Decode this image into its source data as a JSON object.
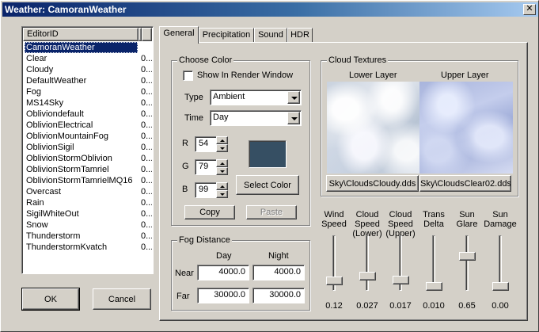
{
  "window": {
    "title": "Weather: CamoranWeather"
  },
  "list": {
    "header": "EditorID",
    "items": [
      {
        "name": "CamoranWeather",
        "extra": "",
        "selected": true
      },
      {
        "name": "Clear",
        "extra": "0..."
      },
      {
        "name": "Cloudy",
        "extra": "0..."
      },
      {
        "name": "DefaultWeather",
        "extra": "0..."
      },
      {
        "name": "Fog",
        "extra": "0..."
      },
      {
        "name": "MS14Sky",
        "extra": "0..."
      },
      {
        "name": "Obliviondefault",
        "extra": "0..."
      },
      {
        "name": "OblivionElectrical",
        "extra": "0..."
      },
      {
        "name": "OblivionMountainFog",
        "extra": "0..."
      },
      {
        "name": "OblivionSigil",
        "extra": "0..."
      },
      {
        "name": "OblivionStormOblivion",
        "extra": "0..."
      },
      {
        "name": "OblivionStormTamriel",
        "extra": "0..."
      },
      {
        "name": "OblivionStormTamrielMQ16",
        "extra": "0..."
      },
      {
        "name": "Overcast",
        "extra": "0..."
      },
      {
        "name": "Rain",
        "extra": "0..."
      },
      {
        "name": "SigilWhiteOut",
        "extra": "0..."
      },
      {
        "name": "Snow",
        "extra": "0..."
      },
      {
        "name": "Thunderstorm",
        "extra": "0..."
      },
      {
        "name": "ThunderstormKvatch",
        "extra": "0..."
      }
    ]
  },
  "buttons": {
    "ok": "OK",
    "cancel": "Cancel"
  },
  "tabs": [
    "General",
    "Precipitation",
    "Sound",
    "HDR"
  ],
  "choose_color": {
    "title": "Choose Color",
    "show_in_render": "Show In Render Window",
    "type_label": "Type",
    "type_value": "Ambient",
    "time_label": "Time",
    "time_value": "Day",
    "r_label": "R",
    "r_value": "54",
    "g_label": "G",
    "g_value": "79",
    "b_label": "B",
    "b_value": "99",
    "swatch_color": "#364f63",
    "select_color": "Select Color",
    "copy": "Copy",
    "paste": "Paste"
  },
  "fog": {
    "title": "Fog Distance",
    "day": "Day",
    "night": "Night",
    "near_label": "Near",
    "far_label": "Far",
    "near_day": "4000.0",
    "near_night": "4000.0",
    "far_day": "30000.0",
    "far_night": "30000.0"
  },
  "cloud": {
    "title": "Cloud Textures",
    "lower_label": "Lower Layer",
    "upper_label": "Upper Layer",
    "lower_file": "Sky\\CloudsCloudy.dds",
    "upper_file": "Sky\\CloudsClear02.dds"
  },
  "sliders": [
    {
      "label1": "Wind",
      "label2": "Speed",
      "label3": "",
      "value": "0.12",
      "level": 0.12
    },
    {
      "label1": "Cloud",
      "label2": "Speed",
      "label3": "(Lower)",
      "value": "0.027",
      "level": 0.22
    },
    {
      "label1": "Cloud",
      "label2": "Speed",
      "label3": "(Upper)",
      "value": "0.017",
      "level": 0.13
    },
    {
      "label1": "Trans",
      "label2": "Delta",
      "label3": "",
      "value": "0.010",
      "level": 0.0
    },
    {
      "label1": "Sun",
      "label2": "Glare",
      "label3": "",
      "value": "0.65",
      "level": 0.65
    },
    {
      "label1": "Sun",
      "label2": "Damage",
      "label3": "",
      "value": "0.00",
      "level": 0.0
    }
  ]
}
